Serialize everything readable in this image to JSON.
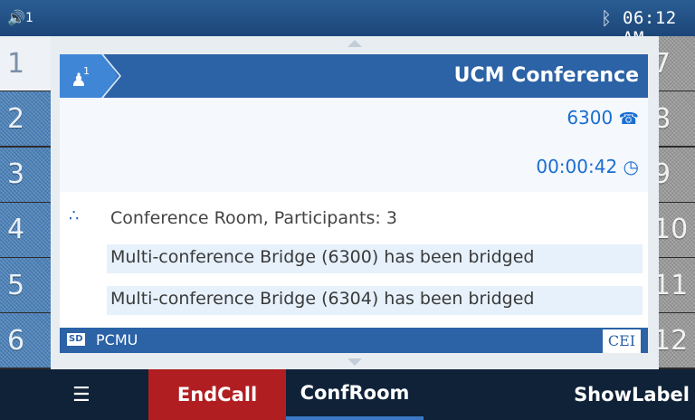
{
  "status_bar": {
    "volume_icon": "speaker-icon",
    "line_indicator": "1",
    "bluetooth_icon": "bluetooth-icon",
    "time": "06:12 AM"
  },
  "left_keys": [
    "1",
    "2",
    "3",
    "4",
    "5",
    "6"
  ],
  "right_keys": [
    "7",
    "8",
    "9",
    "10",
    "11",
    "12"
  ],
  "call": {
    "participant_count": "1",
    "title": "UCM Conference",
    "number": "6300",
    "duration": "00:00:42"
  },
  "conference": {
    "title": "Conference Room, Participants: 3",
    "messages": [
      "Multi-conference Bridge (6300) has been bridged",
      "Multi-conference Bridge (6304) has been bridged"
    ]
  },
  "codec": {
    "badge": "SD",
    "name": "PCMU",
    "cei_label": "CEI"
  },
  "softkeys": {
    "endcall": "EndCall",
    "confroom": "ConfRoom",
    "showlabel": "ShowLabel"
  },
  "colors": {
    "header_blue": "#2c62a6",
    "accent_blue": "#1a6ed0",
    "endcall_red": "#b11e21"
  }
}
